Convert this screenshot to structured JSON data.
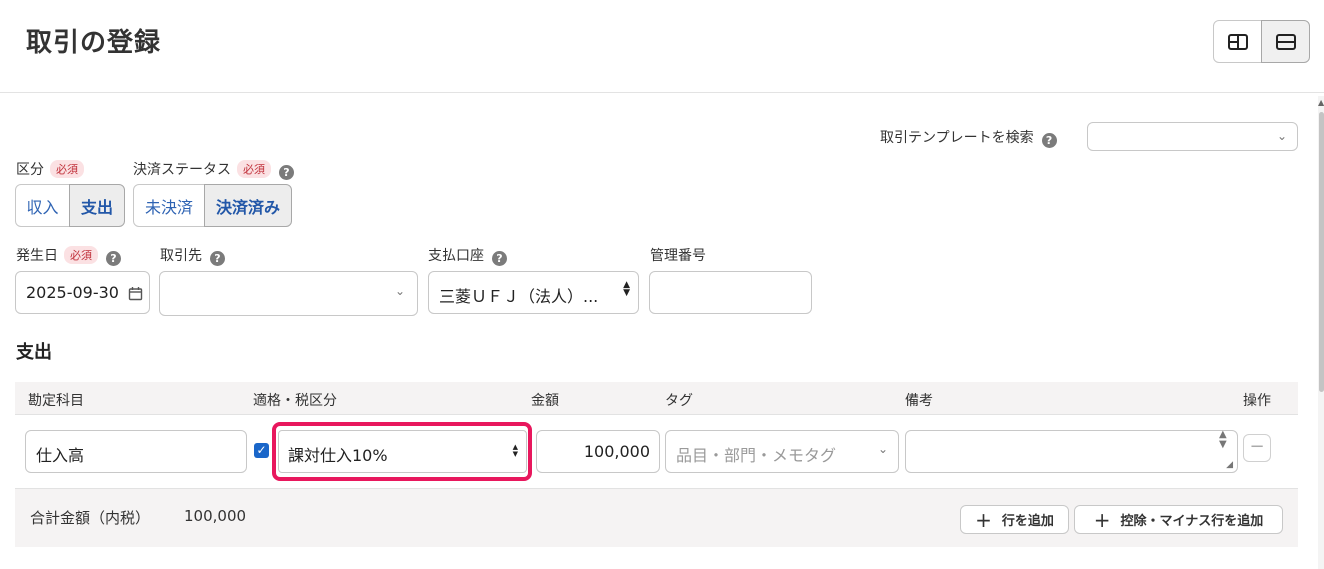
{
  "page": {
    "title": "取引の登録"
  },
  "template_search": {
    "label": "取引テンプレートを検索",
    "help": "?",
    "value": ""
  },
  "kubun": {
    "label": "区分",
    "required": "必須",
    "options": [
      "収入",
      "支出"
    ],
    "selected": "支出"
  },
  "status": {
    "label": "決済ステータス",
    "required": "必須",
    "help": "?",
    "options": [
      "未決済",
      "決済済み"
    ],
    "selected": "決済済み"
  },
  "date": {
    "label": "発生日",
    "required": "必須",
    "help": "?",
    "value": "2025-09-30"
  },
  "partner": {
    "label": "取引先",
    "help": "?",
    "value": ""
  },
  "account": {
    "label": "支払口座",
    "help": "?",
    "value": "三菱ＵＦＪ（法人）..."
  },
  "manage_no": {
    "label": "管理番号",
    "value": ""
  },
  "section": {
    "title": "支出"
  },
  "table": {
    "headers": {
      "account": "勘定科目",
      "tax": "適格・税区分",
      "amount": "金額",
      "tag": "タグ",
      "memo": "備考",
      "ops": "操作"
    },
    "rows": [
      {
        "account": "仕入高",
        "qualified": true,
        "tax": "課対仕入10%",
        "amount": "100,000",
        "tag_placeholder": "品目・部門・メモタグ",
        "memo": ""
      }
    ]
  },
  "footer": {
    "total_label": "合計金額（内税）",
    "total_value": "100,000",
    "add_row": "行を追加",
    "add_minus_row": "控除・マイナス行を追加"
  },
  "colors": {
    "highlight": "#e8175d",
    "link": "#2e63b3"
  }
}
